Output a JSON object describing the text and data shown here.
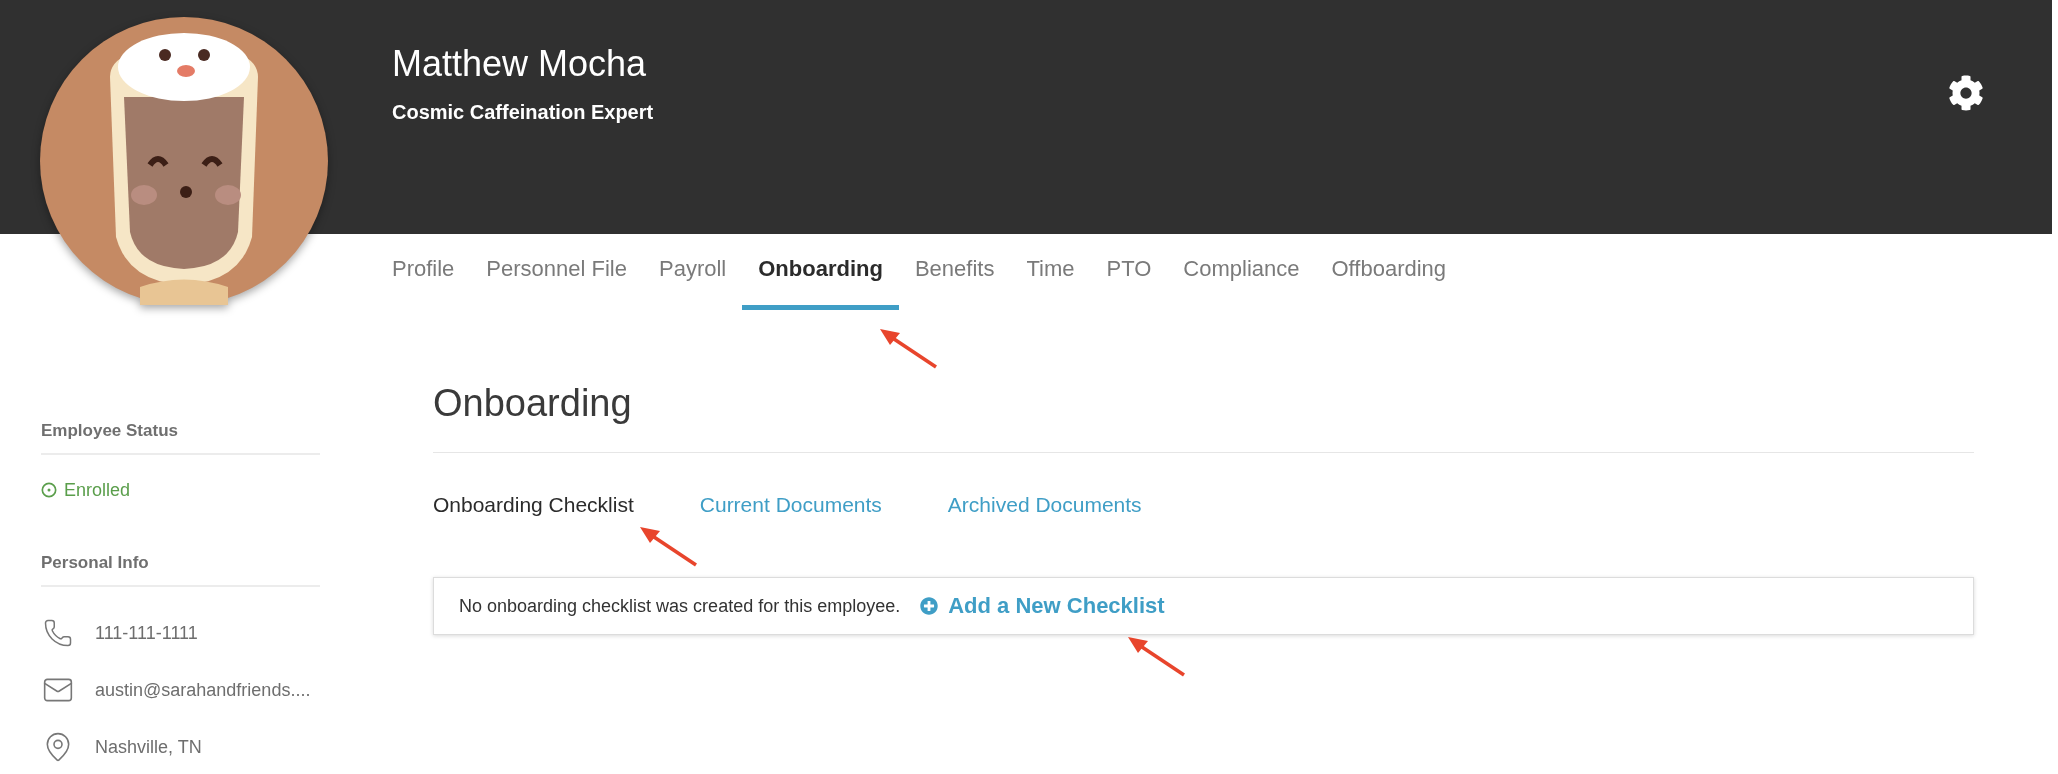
{
  "header": {
    "name": "Matthew Mocha",
    "title": "Cosmic Caffeination Expert"
  },
  "tabs": [
    {
      "label": "Profile",
      "selected": false
    },
    {
      "label": "Personnel File",
      "selected": false
    },
    {
      "label": "Payroll",
      "selected": false
    },
    {
      "label": "Onboarding",
      "selected": true
    },
    {
      "label": "Benefits",
      "selected": false
    },
    {
      "label": "Time",
      "selected": false
    },
    {
      "label": "PTO",
      "selected": false
    },
    {
      "label": "Compliance",
      "selected": false
    },
    {
      "label": "Offboarding",
      "selected": false
    }
  ],
  "sidebar": {
    "sections": [
      {
        "heading": "Employee Status",
        "items": [
          {
            "kind": "status",
            "text": "Enrolled"
          }
        ]
      },
      {
        "heading": "Personal Info",
        "items": [
          {
            "kind": "phone",
            "text": "111-111-1111"
          },
          {
            "kind": "email",
            "text": "austin@sarahandfriends...."
          },
          {
            "kind": "location",
            "text": "Nashville, TN"
          }
        ]
      }
    ]
  },
  "page": {
    "heading": "Onboarding",
    "subtabs": [
      {
        "label": "Onboarding Checklist",
        "selected": true
      },
      {
        "label": "Current Documents",
        "selected": false
      },
      {
        "label": "Archived Documents",
        "selected": false
      }
    ],
    "notice": {
      "message": "No onboarding checklist was created for this employee.",
      "action": "Add a New Checklist"
    }
  }
}
